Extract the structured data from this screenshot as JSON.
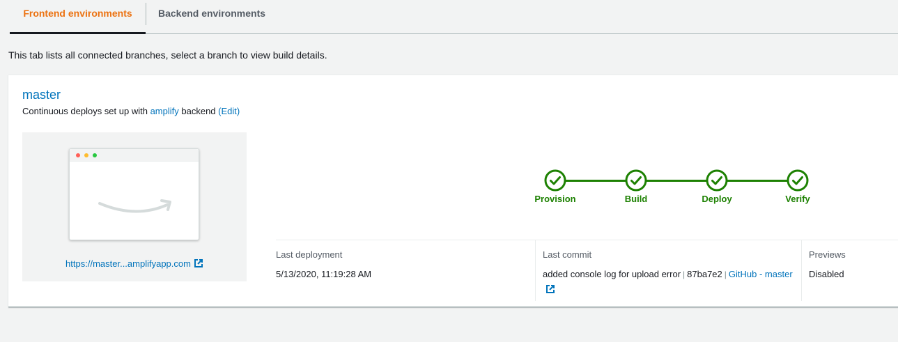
{
  "tabs": {
    "frontend": "Frontend environments",
    "backend": "Backend environments"
  },
  "intro": "This tab lists all connected branches, select a branch to view build details.",
  "branch": {
    "name": "master",
    "desc_prefix": "Continuous deploys set up with",
    "backend_link": "amplify",
    "desc_suffix": "backend",
    "edit_link": "(Edit)",
    "preview_url": "https://master...amplifyapp.com"
  },
  "pipeline": {
    "stages": [
      "Provision",
      "Build",
      "Deploy",
      "Verify"
    ],
    "status": "succeeded",
    "color": "#1d8102"
  },
  "details": {
    "last_deployment_label": "Last deployment",
    "last_deployment_value": "5/13/2020, 11:19:28 AM",
    "last_commit_label": "Last commit",
    "commit_message": "added console log for upload error",
    "commit_hash": "87ba7e2",
    "commit_link": "GitHub - master",
    "previews_label": "Previews",
    "previews_value": "Disabled"
  },
  "colors": {
    "accent": "#ec7211",
    "link": "#0073bb",
    "success": "#1d8102"
  }
}
